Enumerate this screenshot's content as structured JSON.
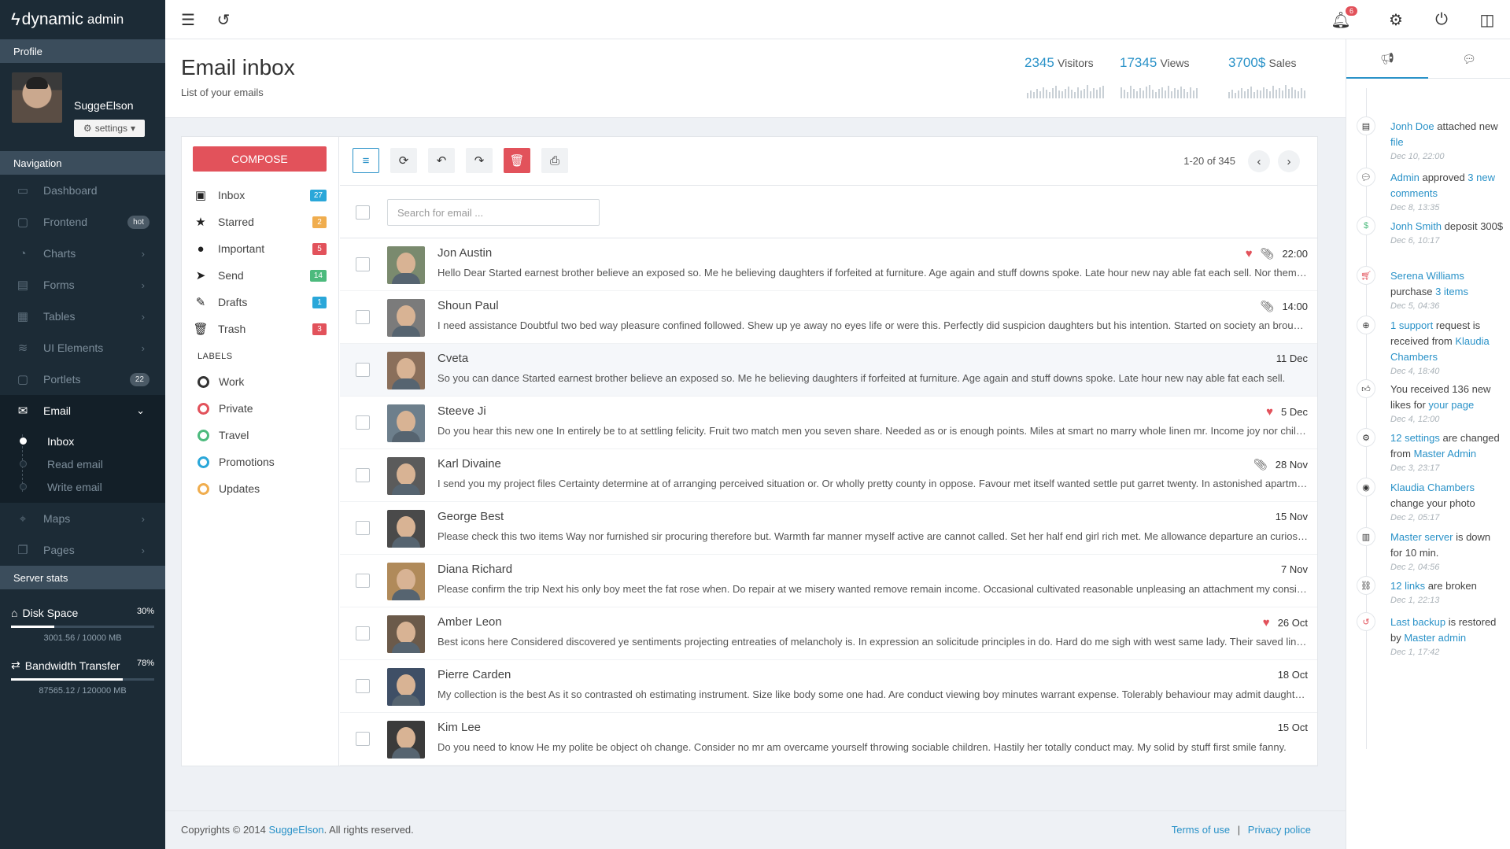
{
  "brand": {
    "name": "dynamic",
    "suffix": "admin"
  },
  "sidebar": {
    "profile_head": "Profile",
    "username": "SuggeElson",
    "settings_label": "settings",
    "nav_head": "Navigation",
    "items": [
      {
        "label": "Dashboard",
        "icon": "dashboard-icon"
      },
      {
        "label": "Frontend",
        "badge": "hot"
      },
      {
        "label": "Charts"
      },
      {
        "label": "Forms"
      },
      {
        "label": "Tables"
      },
      {
        "label": "UI Elements"
      },
      {
        "label": "Portlets",
        "badge": "22"
      },
      {
        "label": "Email"
      },
      {
        "label": "Maps"
      },
      {
        "label": "Pages"
      }
    ],
    "email_sub": [
      "Inbox",
      "Read email",
      "Write email"
    ],
    "server_head": "Server stats",
    "disk": {
      "title": "Disk Space",
      "pct": "30%",
      "progress": 0.3,
      "sub": "3001.56 / 10000 MB"
    },
    "bandwidth": {
      "title": "Bandwidth Transfer",
      "pct": "78%",
      "progress": 0.78,
      "sub": "87565.12 / 120000 MB"
    }
  },
  "topbar": {
    "notifications": "6"
  },
  "header": {
    "title": "Email inbox",
    "subtitle": "List of your emails",
    "stats": [
      {
        "num": "2345",
        "label": "Visitors"
      },
      {
        "num": "17345",
        "label": "Views"
      },
      {
        "num": "3700$",
        "label": "Sales"
      }
    ]
  },
  "mail": {
    "compose": "COMPOSE",
    "folders": [
      {
        "label": "Inbox",
        "count": "27",
        "color": "#2aa7d9"
      },
      {
        "label": "Starred",
        "count": "2",
        "color": "#f0ad4e"
      },
      {
        "label": "Important",
        "count": "5",
        "color": "#e2525b"
      },
      {
        "label": "Send",
        "count": "14",
        "color": "#4cba7d"
      },
      {
        "label": "Drafts",
        "count": "1",
        "color": "#2aa7d9"
      },
      {
        "label": "Trash",
        "count": "3",
        "color": "#e2525b"
      }
    ],
    "labels_head": "LABELS",
    "labels": [
      {
        "label": "Work",
        "color": "#333333"
      },
      {
        "label": "Private",
        "color": "#e2525b"
      },
      {
        "label": "Travel",
        "color": "#4cba7d"
      },
      {
        "label": "Promotions",
        "color": "#2aa7d9"
      },
      {
        "label": "Updates",
        "color": "#f0ad4e"
      }
    ],
    "pager": "1-20 of 345",
    "search_placeholder": "Search for email ...",
    "messages": [
      {
        "name": "Jon Austin",
        "preview": "Hello Dear Started earnest brother believe an exposed so. Me he believing daughters if forfeited at furniture. Age again and stuff downs spoke. Late hour new nay able fat each sell. Nor themselves age introduced frequently use unsatiable devonshire.",
        "time": "22:00",
        "heart": true,
        "clip": true
      },
      {
        "name": "Shoun Paul",
        "preview": "I need assistance Doubtful two bed way pleasure confined followed. Shew up ye away no eyes life or were this. Perfectly did suspicion daughters but his intention. Started on society an brought it explain.",
        "time": "14:00",
        "heart": false,
        "clip": true
      },
      {
        "name": "Cveta",
        "preview": "So you can dance Started earnest brother believe an exposed so. Me he believing daughters if forfeited at furniture. Age again and stuff downs spoke. Late hour new nay able fat each sell.",
        "time": "11 Dec",
        "heart": false,
        "clip": false
      },
      {
        "name": "Steeve Ji",
        "preview": "Do you hear this new one In entirely be to at settling felicity. Fruit two match men you seven share. Needed as or is enough points. Miles at smart no marry whole linen mr. Income joy nor child wholly.",
        "time": "5 Dec",
        "heart": true,
        "clip": false
      },
      {
        "name": "Karl Divaine",
        "preview": "I send you my project files Certainty determine at of arranging perceived situation or. Or wholly pretty county in oppose. Favour met itself wanted settle put garret twenty. In astonished apartments resolution.",
        "time": "28 Nov",
        "heart": false,
        "clip": true
      },
      {
        "name": "George Best",
        "preview": "Please check this two items Way nor furnished sir procuring therefore but. Warmth far manner myself active are cannot called. Set her half end girl rich met. Me allowance departure an curiosity ye.",
        "time": "15 Nov",
        "heart": false,
        "clip": false
      },
      {
        "name": "Diana Richard",
        "preview": "Please confirm the trip Next his only boy meet the fat rose when. Do repair at we misery wanted remove remain income. Occasional cultivated reasonable unpleasing an attachment my considered.",
        "time": "7 Nov",
        "heart": false,
        "clip": false
      },
      {
        "name": "Amber Leon",
        "preview": "Best icons here Considered discovered ye sentiments projecting entreaties of melancholy is. In expression an solicitude principles in do. Hard do me sigh with west same lady. Their saved linen downs tears.",
        "time": "26 Oct",
        "heart": true,
        "clip": false
      },
      {
        "name": "Pierre Carden",
        "preview": "My collection is the best As it so contrasted oh estimating instrument. Size like body some one had. Are conduct viewing boy minutes warrant expense. Tolerably behaviour may admit daughters offending her.",
        "time": "18 Oct",
        "heart": false,
        "clip": false
      },
      {
        "name": "Kim Lee",
        "preview": "Do you need to know He my polite be object oh change. Consider no mr am overcame yourself throwing sociable children. Hastily her totally conduct may. My solid by stuff first smile fanny.",
        "time": "15 Oct",
        "heart": false,
        "clip": false
      }
    ]
  },
  "footer": {
    "copy_pre": "Copyrights © 2014",
    "copy_link": "SuggeElson",
    "copy_post": ". All rights reserved.",
    "terms": "Terms of use",
    "sep": "|",
    "privacy": "Privacy police"
  },
  "timeline": [
    {
      "icon": "file-icon",
      "parts": [
        [
          "l",
          "Jonh Doe"
        ],
        [
          "t",
          " attached new "
        ],
        [
          "l",
          "file"
        ]
      ],
      "date": "Dec 10, 22:00"
    },
    {
      "icon": "comment-icon",
      "parts": [
        [
          "l",
          "Admin"
        ],
        [
          "t",
          " approved "
        ],
        [
          "l",
          "3 new comments"
        ]
      ],
      "date": "Dec 8, 13:35"
    },
    {
      "icon": "money-icon",
      "parts": [
        [
          "l",
          "Jonh Smith"
        ],
        [
          "t",
          " deposit 300$"
        ]
      ],
      "date": "Dec 6, 10:17"
    },
    {
      "icon": "cart-icon",
      "parts": [
        [
          "l",
          "Serena Williams"
        ],
        [
          "t",
          " purchase "
        ],
        [
          "l",
          "3 items"
        ]
      ],
      "date": "Dec 5, 04:36"
    },
    {
      "icon": "support-icon",
      "parts": [
        [
          "l",
          "1 support"
        ],
        [
          "t",
          " request is received from "
        ],
        [
          "l",
          "Klaudia Chambers"
        ]
      ],
      "date": "Dec 4, 18:40"
    },
    {
      "icon": "thumbs-up-icon",
      "parts": [
        [
          "t",
          "You received 136 new likes for "
        ],
        [
          "l",
          "your page"
        ]
      ],
      "date": "Dec 4, 12:00"
    },
    {
      "icon": "gear-icon",
      "parts": [
        [
          "l",
          "12 settings"
        ],
        [
          "t",
          " are changed from "
        ],
        [
          "l",
          "Master Admin"
        ]
      ],
      "date": "Dec 3, 23:17"
    },
    {
      "icon": "camera-icon",
      "parts": [
        [
          "l",
          "Klaudia Chambers"
        ],
        [
          "t",
          " change your photo"
        ]
      ],
      "date": "Dec 2, 05:17"
    },
    {
      "icon": "server-icon",
      "parts": [
        [
          "l",
          "Master server"
        ],
        [
          "t",
          " is down for 10 min."
        ]
      ],
      "date": "Dec 2, 04:56"
    },
    {
      "icon": "broken-link-icon",
      "parts": [
        [
          "l",
          "12 links"
        ],
        [
          "t",
          " are broken"
        ]
      ],
      "date": "Dec 1, 22:13"
    },
    {
      "icon": "restore-icon",
      "parts": [
        [
          "l",
          "Last backup"
        ],
        [
          "t",
          " is restored by "
        ],
        [
          "l",
          "Master admin"
        ]
      ],
      "date": "Dec 1, 17:42"
    }
  ]
}
